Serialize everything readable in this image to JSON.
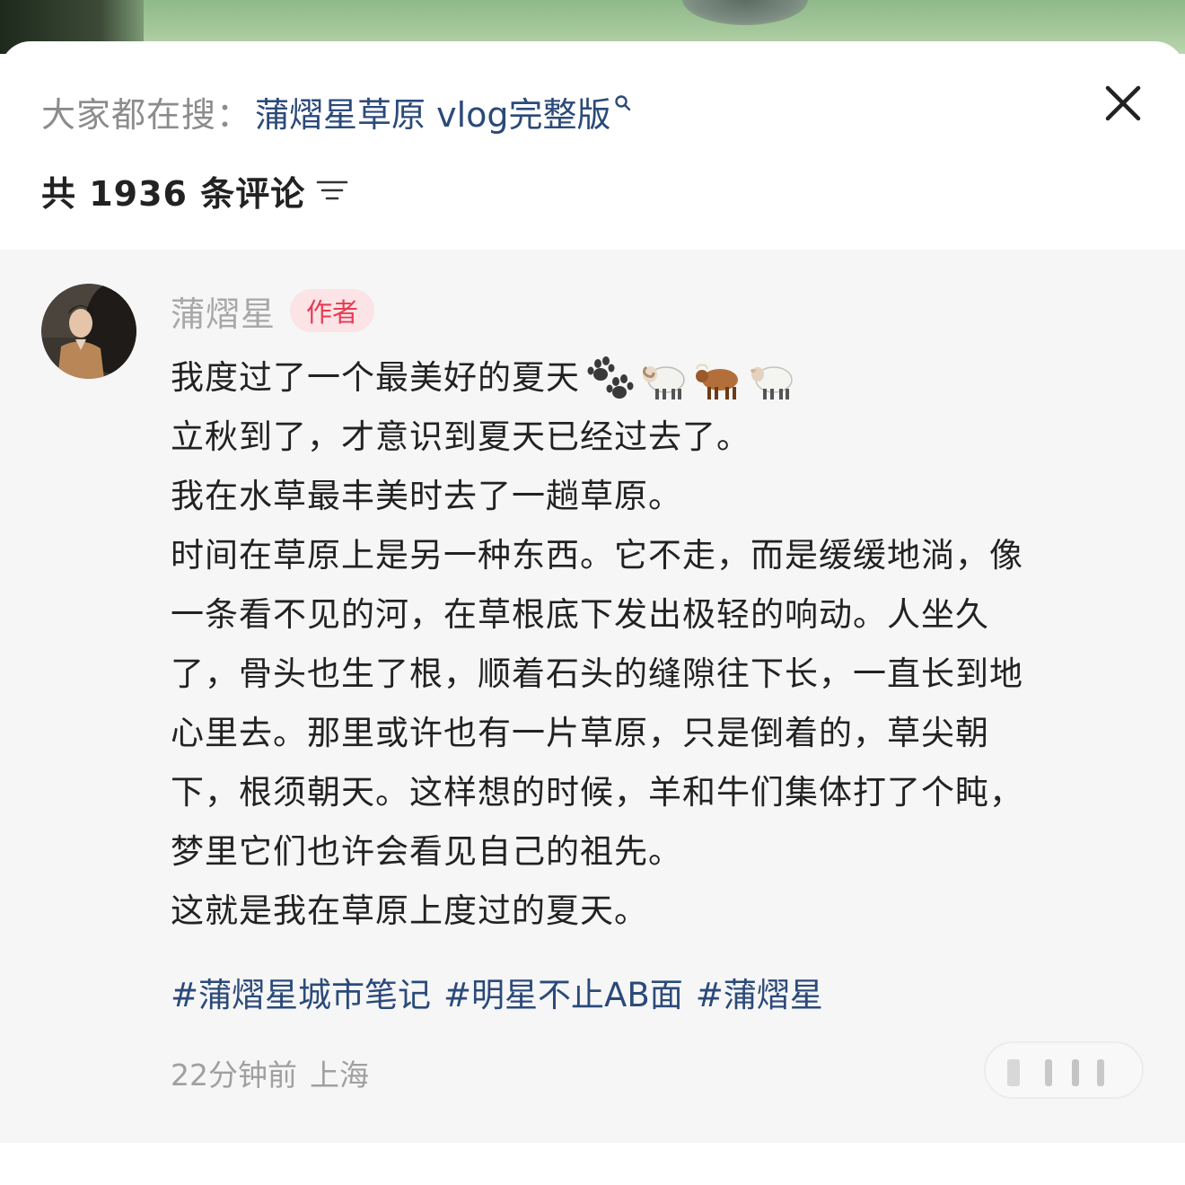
{
  "search": {
    "prefix": "大家都在搜：",
    "term": "蒲熠星草原 vlog完整版"
  },
  "comments_header": {
    "count_text": "共 1936 条评论"
  },
  "comment": {
    "author": "蒲熠星",
    "badge": "作者",
    "lines": [
      "我度过了一个最美好的夏天",
      "立秋到了，才意识到夏天已经过去了。",
      "我在水草最丰美时去了一趟草原。",
      "时间在草原上是另一种东西。它不走，而是缓缓地淌，像",
      "一条看不见的河，在草根底下发出极轻的响动。人坐久",
      "了，骨头也生了根，顺着石头的缝隙往下长，一直长到地",
      "心里去。那里或许也有一片草原，只是倒着的，草尖朝",
      "下，根须朝天。这样想的时候，羊和牛们集体打了个盹，",
      "梦里它们也许会看见自己的祖先。",
      "这就是我在草原上度过的夏天。"
    ],
    "emojis": [
      "paw-prints-emoji",
      "ram-emoji",
      "ox-emoji",
      "sheep-emoji"
    ],
    "tags": [
      "#蒲熠星城市笔记",
      "#明星不止AB面",
      "#蒲熠星"
    ],
    "time": "22分钟前",
    "location": "上海"
  },
  "colors": {
    "link": "#2b4a7a",
    "badge_bg": "#fbe3e6",
    "badge_text": "#e83a52",
    "card_bg": "#f6f6f6"
  }
}
